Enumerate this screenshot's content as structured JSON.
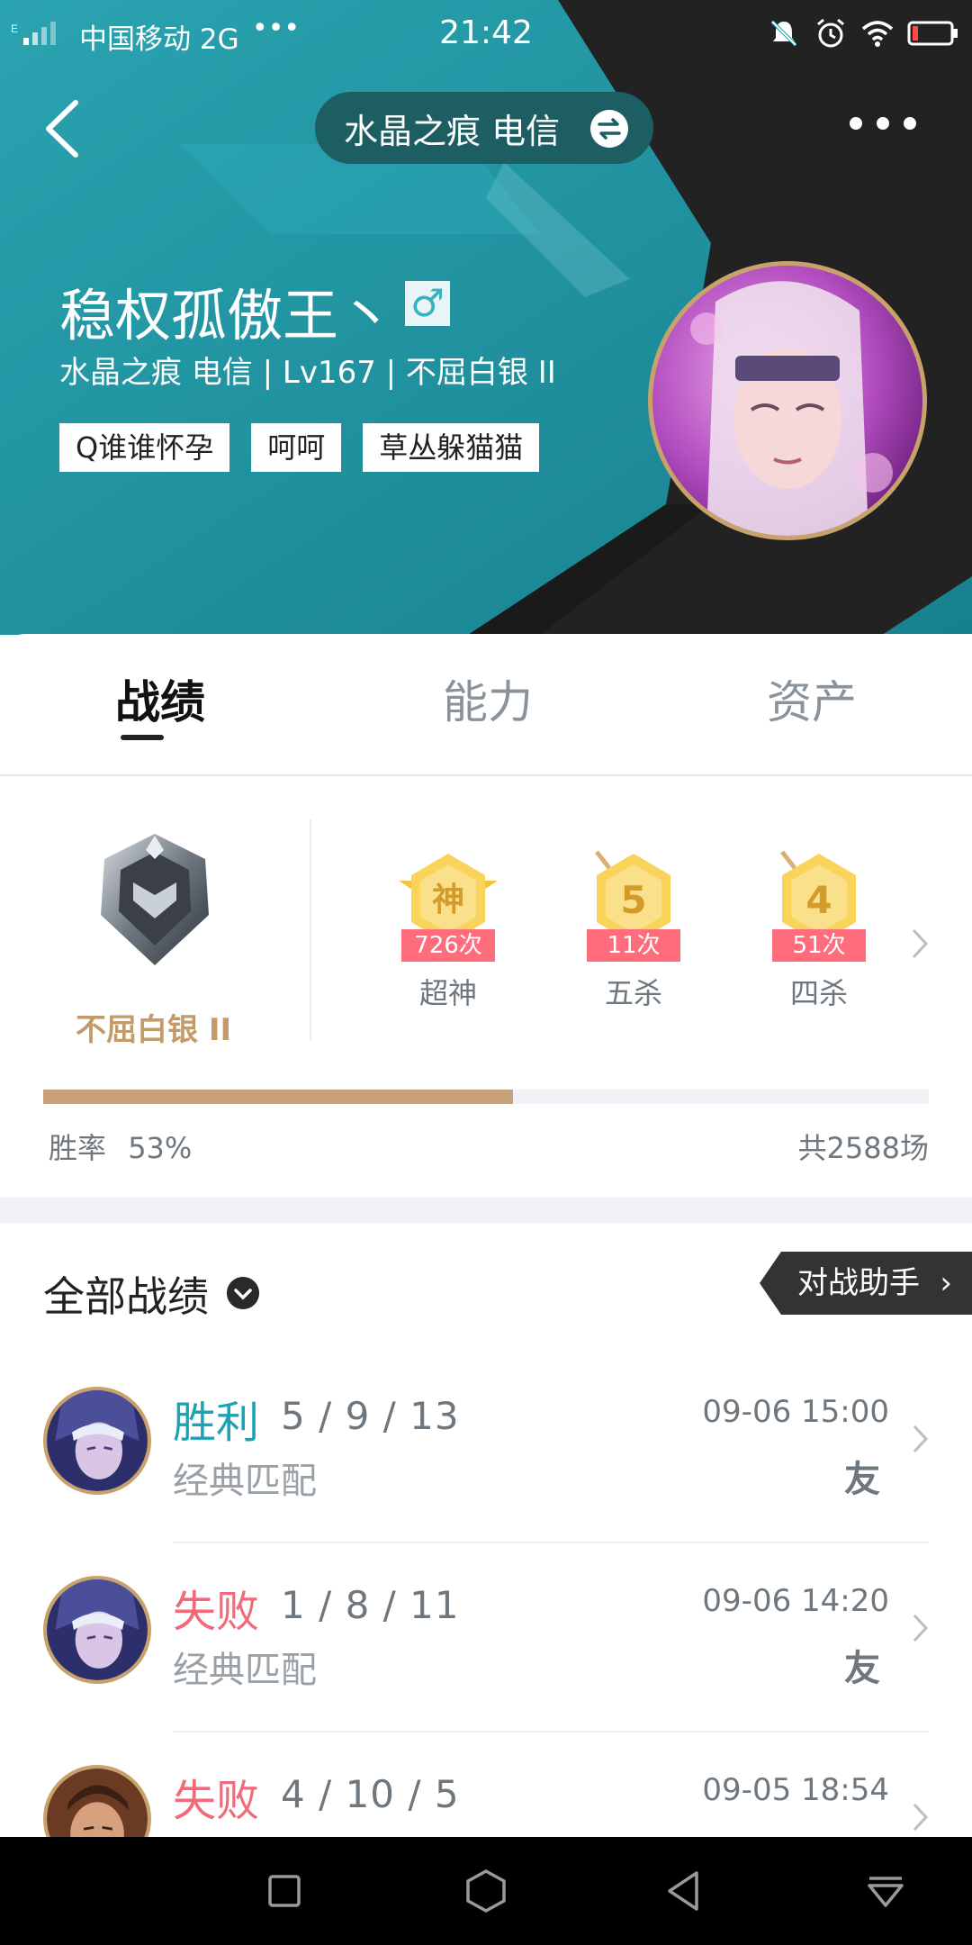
{
  "status_bar": {
    "carrier": "中国移动 2G",
    "dots": "•••",
    "time": "21:42",
    "icons": [
      "mute-icon",
      "alarm-icon",
      "wifi-icon",
      "battery-icon"
    ]
  },
  "nav": {
    "server": "水晶之痕 电信"
  },
  "profile": {
    "nickname": "稳权孤傲王丶",
    "gender_symbol": "♂",
    "info_line": "水晶之痕 电信 | Lv167 | 不屈白银 II",
    "tags": [
      "Q谁谁怀孕",
      "呵呵",
      "草丛躲猫猫"
    ]
  },
  "tabs": {
    "items": [
      "战绩",
      "能力",
      "资产"
    ],
    "active": "战绩"
  },
  "rank": {
    "tier": "不屈白银 II",
    "badges": [
      {
        "symbol": "神",
        "count": "726次",
        "name": "超神"
      },
      {
        "symbol": "5",
        "count": "11次",
        "name": "五杀"
      },
      {
        "symbol": "4",
        "count": "51次",
        "name": "四杀"
      }
    ],
    "win_rate_label": "胜率",
    "win_rate_value": "53%",
    "win_rate_fraction": 0.53,
    "total_games": "共2588场"
  },
  "records": {
    "title": "全部战绩",
    "assist_button": "对战助手",
    "items": [
      {
        "result": "胜利",
        "kda": "5 / 9 / 13",
        "mode": "经典匹配",
        "time": "09-06 15:00",
        "tag": "友"
      },
      {
        "result": "失败",
        "kda": "1 / 8 / 11",
        "mode": "经典匹配",
        "time": "09-06 14:20",
        "tag": "友"
      },
      {
        "result": "失败",
        "kda": "4 / 10 / 5",
        "mode": "",
        "time": "09-05 18:54",
        "tag": ""
      }
    ]
  },
  "colors": {
    "header_teal": "#1f8f9e",
    "header_dark": "#222222",
    "win": "#1aa3b5",
    "lose": "#f06a7a",
    "rank_gold": "#c39b6b",
    "badge_ribbon": "#ff6d7c"
  }
}
